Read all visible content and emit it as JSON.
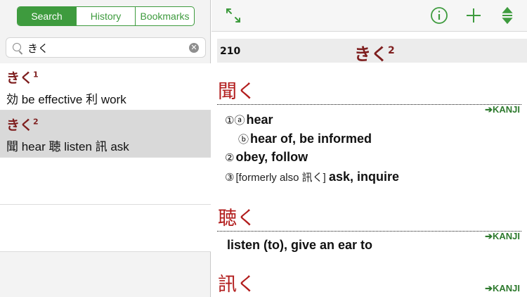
{
  "tabs": [
    "Search",
    "History",
    "Bookmarks"
  ],
  "search": {
    "value": "きく",
    "clear_glyph": "✕"
  },
  "results": [
    {
      "head": "きく",
      "sup": "1",
      "gloss_parts": [
        {
          "jp": "効",
          "en": " be effective "
        },
        {
          "jp": "利",
          "en": " work"
        }
      ]
    },
    {
      "head": "きく",
      "sup": "2",
      "gloss_parts": [
        {
          "jp": "聞",
          "en": " hear "
        },
        {
          "jp": "聴",
          "en": " listen "
        },
        {
          "jp": "訊",
          "en": " ask"
        }
      ]
    }
  ],
  "toolbar": {
    "expand_icon": "expand-arrows-icon",
    "info_icon": "info-circle-icon",
    "add_icon": "plus-icon",
    "nav_icon": "up-down-arrows-icon",
    "accent": "#3e9b3e"
  },
  "entry": {
    "number": "210",
    "reading": "きく",
    "reading_sup": "2",
    "kanji_link_label": "➔KANJI",
    "senses": [
      {
        "kanji": "聞く",
        "lines": [
          {
            "mark": "①ⓐ",
            "note": "",
            "text": "hear"
          },
          {
            "mark": "ⓑ",
            "note": "",
            "text": "hear of, be informed"
          },
          {
            "mark": "②",
            "note": "",
            "text": "obey, follow"
          },
          {
            "mark": "③",
            "note": "[formerly also 訊く] ",
            "text": "ask, inquire"
          }
        ]
      },
      {
        "kanji": "聴く",
        "lines": [
          {
            "mark": "",
            "note": "",
            "text": "listen (to), give an ear to"
          }
        ]
      },
      {
        "kanji": "訊く",
        "lines": []
      }
    ]
  },
  "colors": {
    "headword": "#7e1e1e",
    "sense_kanji": "#b21d1d",
    "kanji_link": "#2e7a2e",
    "selection": "#d9d9d9"
  }
}
